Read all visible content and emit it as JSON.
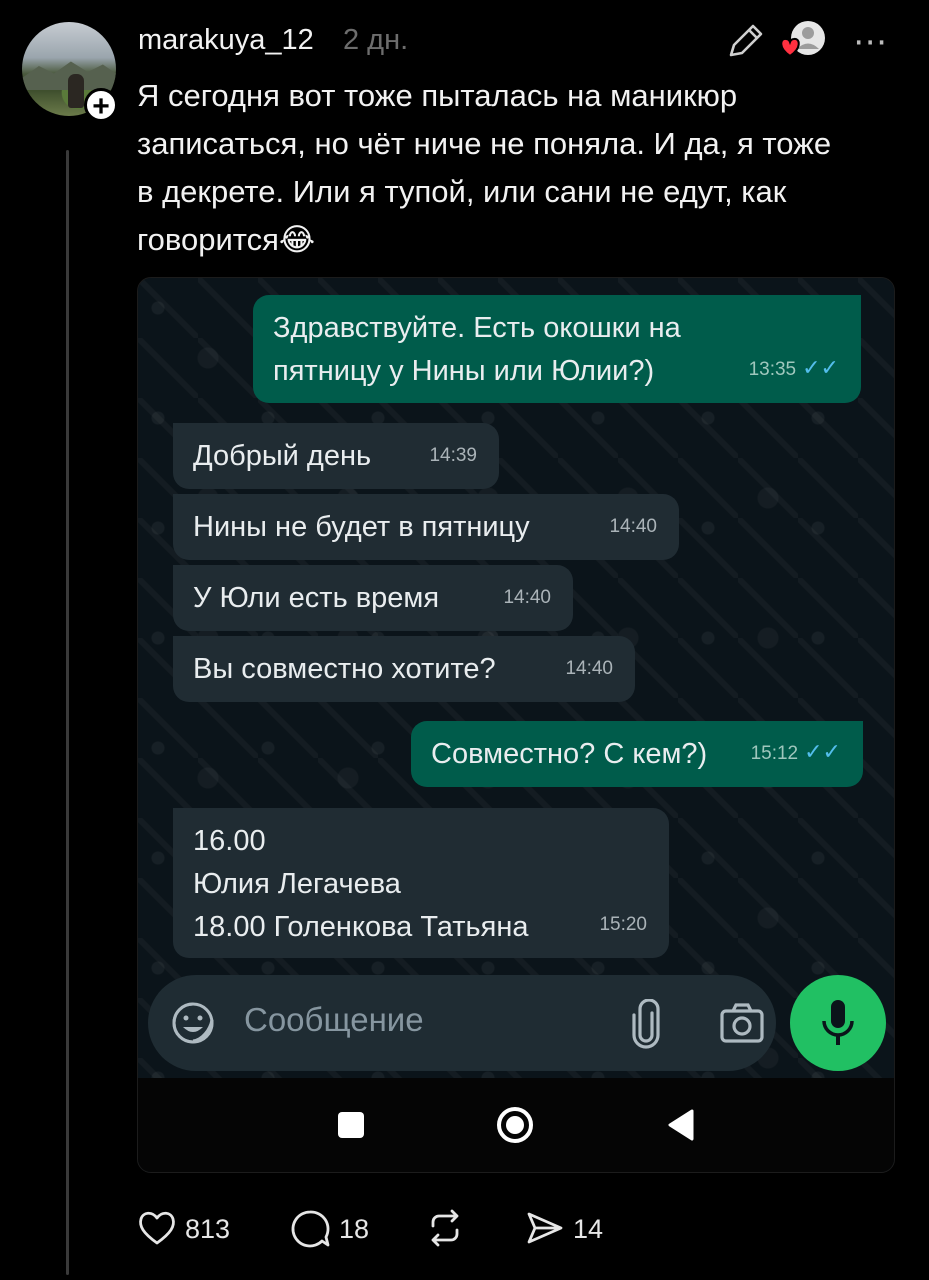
{
  "post": {
    "username": "marakuya_12",
    "time_ago": "2 дн.",
    "text": "Я сегодня вот тоже пыталась на маникюр\nзаписаться, но чёт ниче не поняла. И да, я тоже\nв декрете. Или я тупой, или сани не едут, как\nговорится😂"
  },
  "chat": {
    "messages": [
      {
        "dir": "out",
        "text": "Здравствуйте. Есть окошки на\nпятницу у Нины или Юлии?)",
        "time": "13:35",
        "ticks": "✓✓"
      },
      {
        "dir": "in",
        "text": "Добрый день",
        "time": "14:39"
      },
      {
        "dir": "in",
        "text": "Нины не будет в пятницу",
        "time": "14:40"
      },
      {
        "dir": "in",
        "text": "У Юли есть время",
        "time": "14:40"
      },
      {
        "dir": "in",
        "text": "Вы совместно хотите?",
        "time": "14:40"
      },
      {
        "dir": "out",
        "text": "Совместно? С кем?)",
        "time": "15:12",
        "ticks": "✓✓"
      },
      {
        "dir": "in",
        "text": "16.00\n Юлия Легачева\n18.00 Голенкова Татьяна",
        "time": "15:20"
      }
    ],
    "composer_placeholder": "Сообщение",
    "icons": [
      "emoji-icon",
      "paperclip-icon",
      "camera-icon",
      "mic-icon"
    ]
  },
  "actions": {
    "likes": "813",
    "comments": "18",
    "reposts": "",
    "shares": "14"
  },
  "colors": {
    "background": "#000000",
    "outgoing_bubble": "#005c4b",
    "incoming_bubble": "#202c33",
    "mic_button": "#21c063",
    "read_ticks": "#53bdeb"
  }
}
